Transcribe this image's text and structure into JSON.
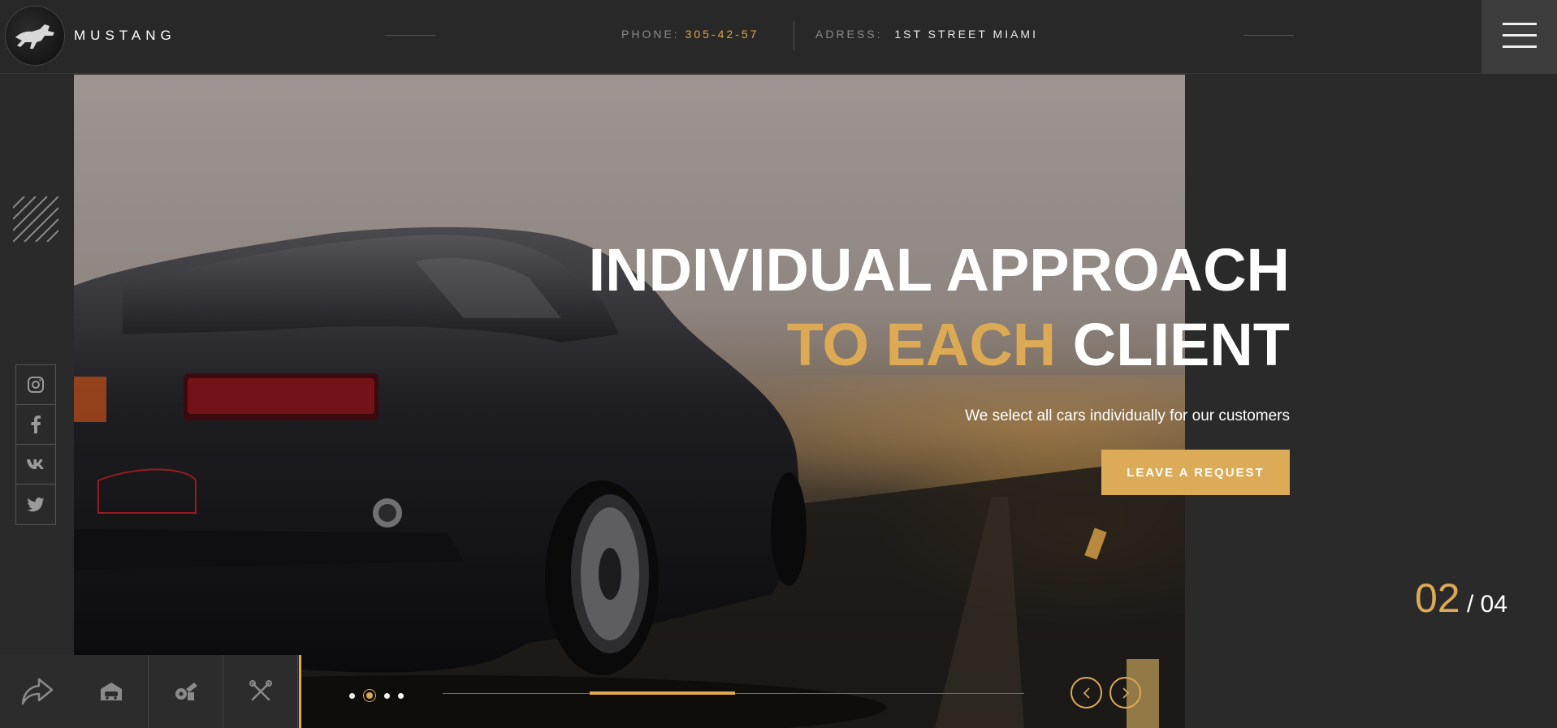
{
  "header": {
    "brand": "MUSTANG",
    "phone_label": "PHONE:",
    "phone_value": "305-42-57",
    "address_label": "ADRESS:",
    "address_value": "1ST STREET MIAMI"
  },
  "hero": {
    "headline_line1": "INDIVIDUAL APPROACH",
    "headline_line2_accent": "TO EACH",
    "headline_line2_rest": "CLIENT",
    "subtitle": "We select all cars individually for our customers",
    "cta_label": "LEAVE A REQUEST",
    "slide_current": "02",
    "slide_total": "/ 04"
  },
  "socials": [
    "instagram-icon",
    "facebook-icon",
    "vk-icon",
    "twitter-icon"
  ],
  "bottom_nav": [
    "share-icon",
    "garage-icon",
    "service-icon",
    "tools-icon"
  ],
  "slider": {
    "total_dots": 4,
    "active_dot": 2,
    "progress": 0.25
  },
  "colors": {
    "accent": "#dcaa55",
    "background": "#2a2a2a",
    "header": "#282828"
  }
}
